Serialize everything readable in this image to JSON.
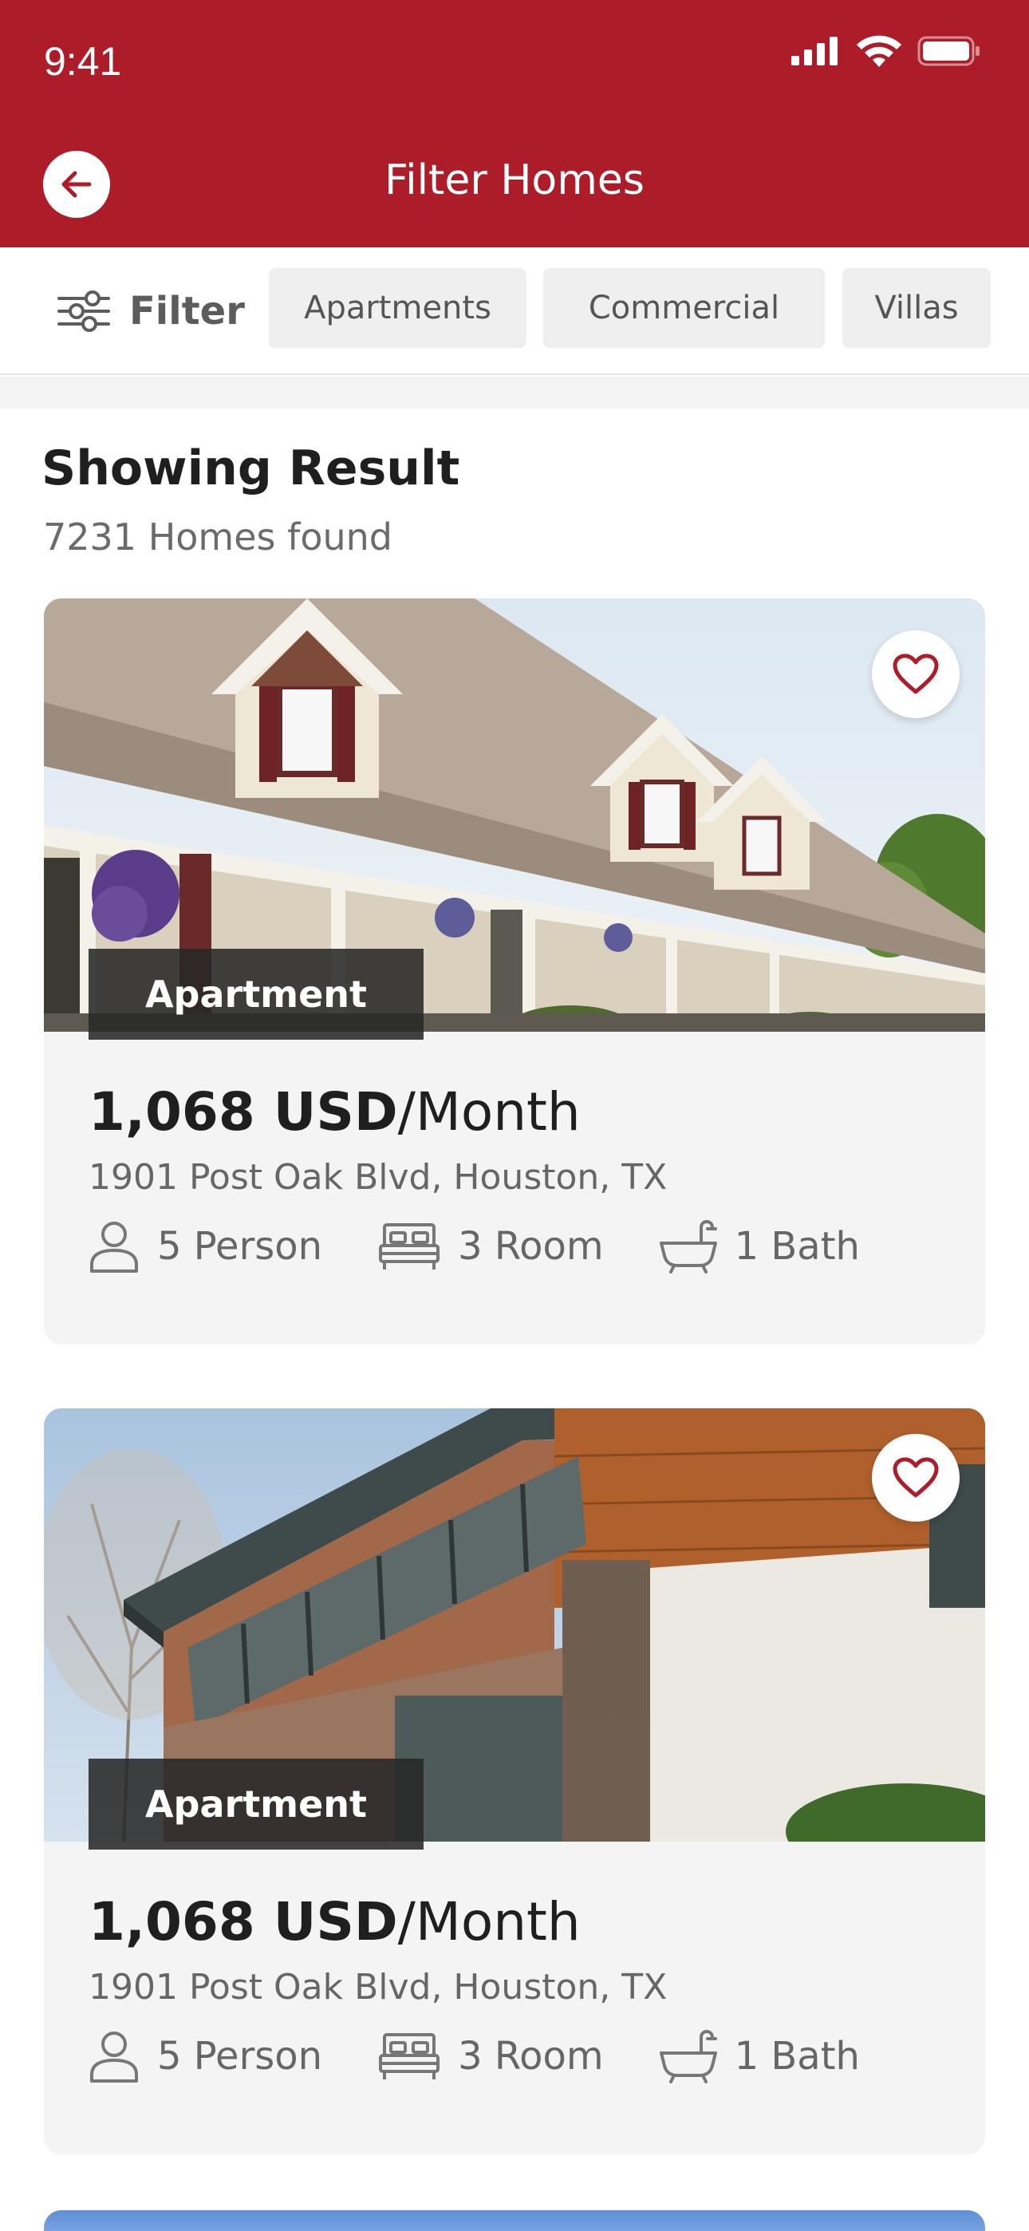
{
  "status_bar": {
    "time": "9:41"
  },
  "header": {
    "title": "Filter Homes"
  },
  "filter_bar": {
    "filter_label": "Filter",
    "chips": [
      "Apartments",
      "Commercial",
      "Villas"
    ]
  },
  "results": {
    "title": "Showing Result",
    "count_text": "7231 Homes found"
  },
  "listings": [
    {
      "type": "Apartment",
      "price": "1,068 USD",
      "period": "/Month",
      "address": "1901 Post Oak Blvd, Houston, TX",
      "persons": "5 Person",
      "rooms": "3 Room",
      "baths": "1 Bath",
      "favorited": false
    },
    {
      "type": "Apartment",
      "price": "1,068 USD",
      "period": "/Month",
      "address": "1901 Post Oak Blvd, Houston, TX",
      "persons": "5 Person",
      "rooms": "3 Room",
      "baths": "1 Bath",
      "favorited": false
    }
  ],
  "colors": {
    "brand": "#ac1c29",
    "card_bg": "#f4f4f4",
    "chip_bg": "#efefef"
  },
  "icons": [
    "back-arrow-icon",
    "signal-icon",
    "wifi-icon",
    "battery-icon",
    "filter-sliders-icon",
    "heart-icon",
    "person-icon",
    "bed-icon",
    "bathtub-icon"
  ]
}
